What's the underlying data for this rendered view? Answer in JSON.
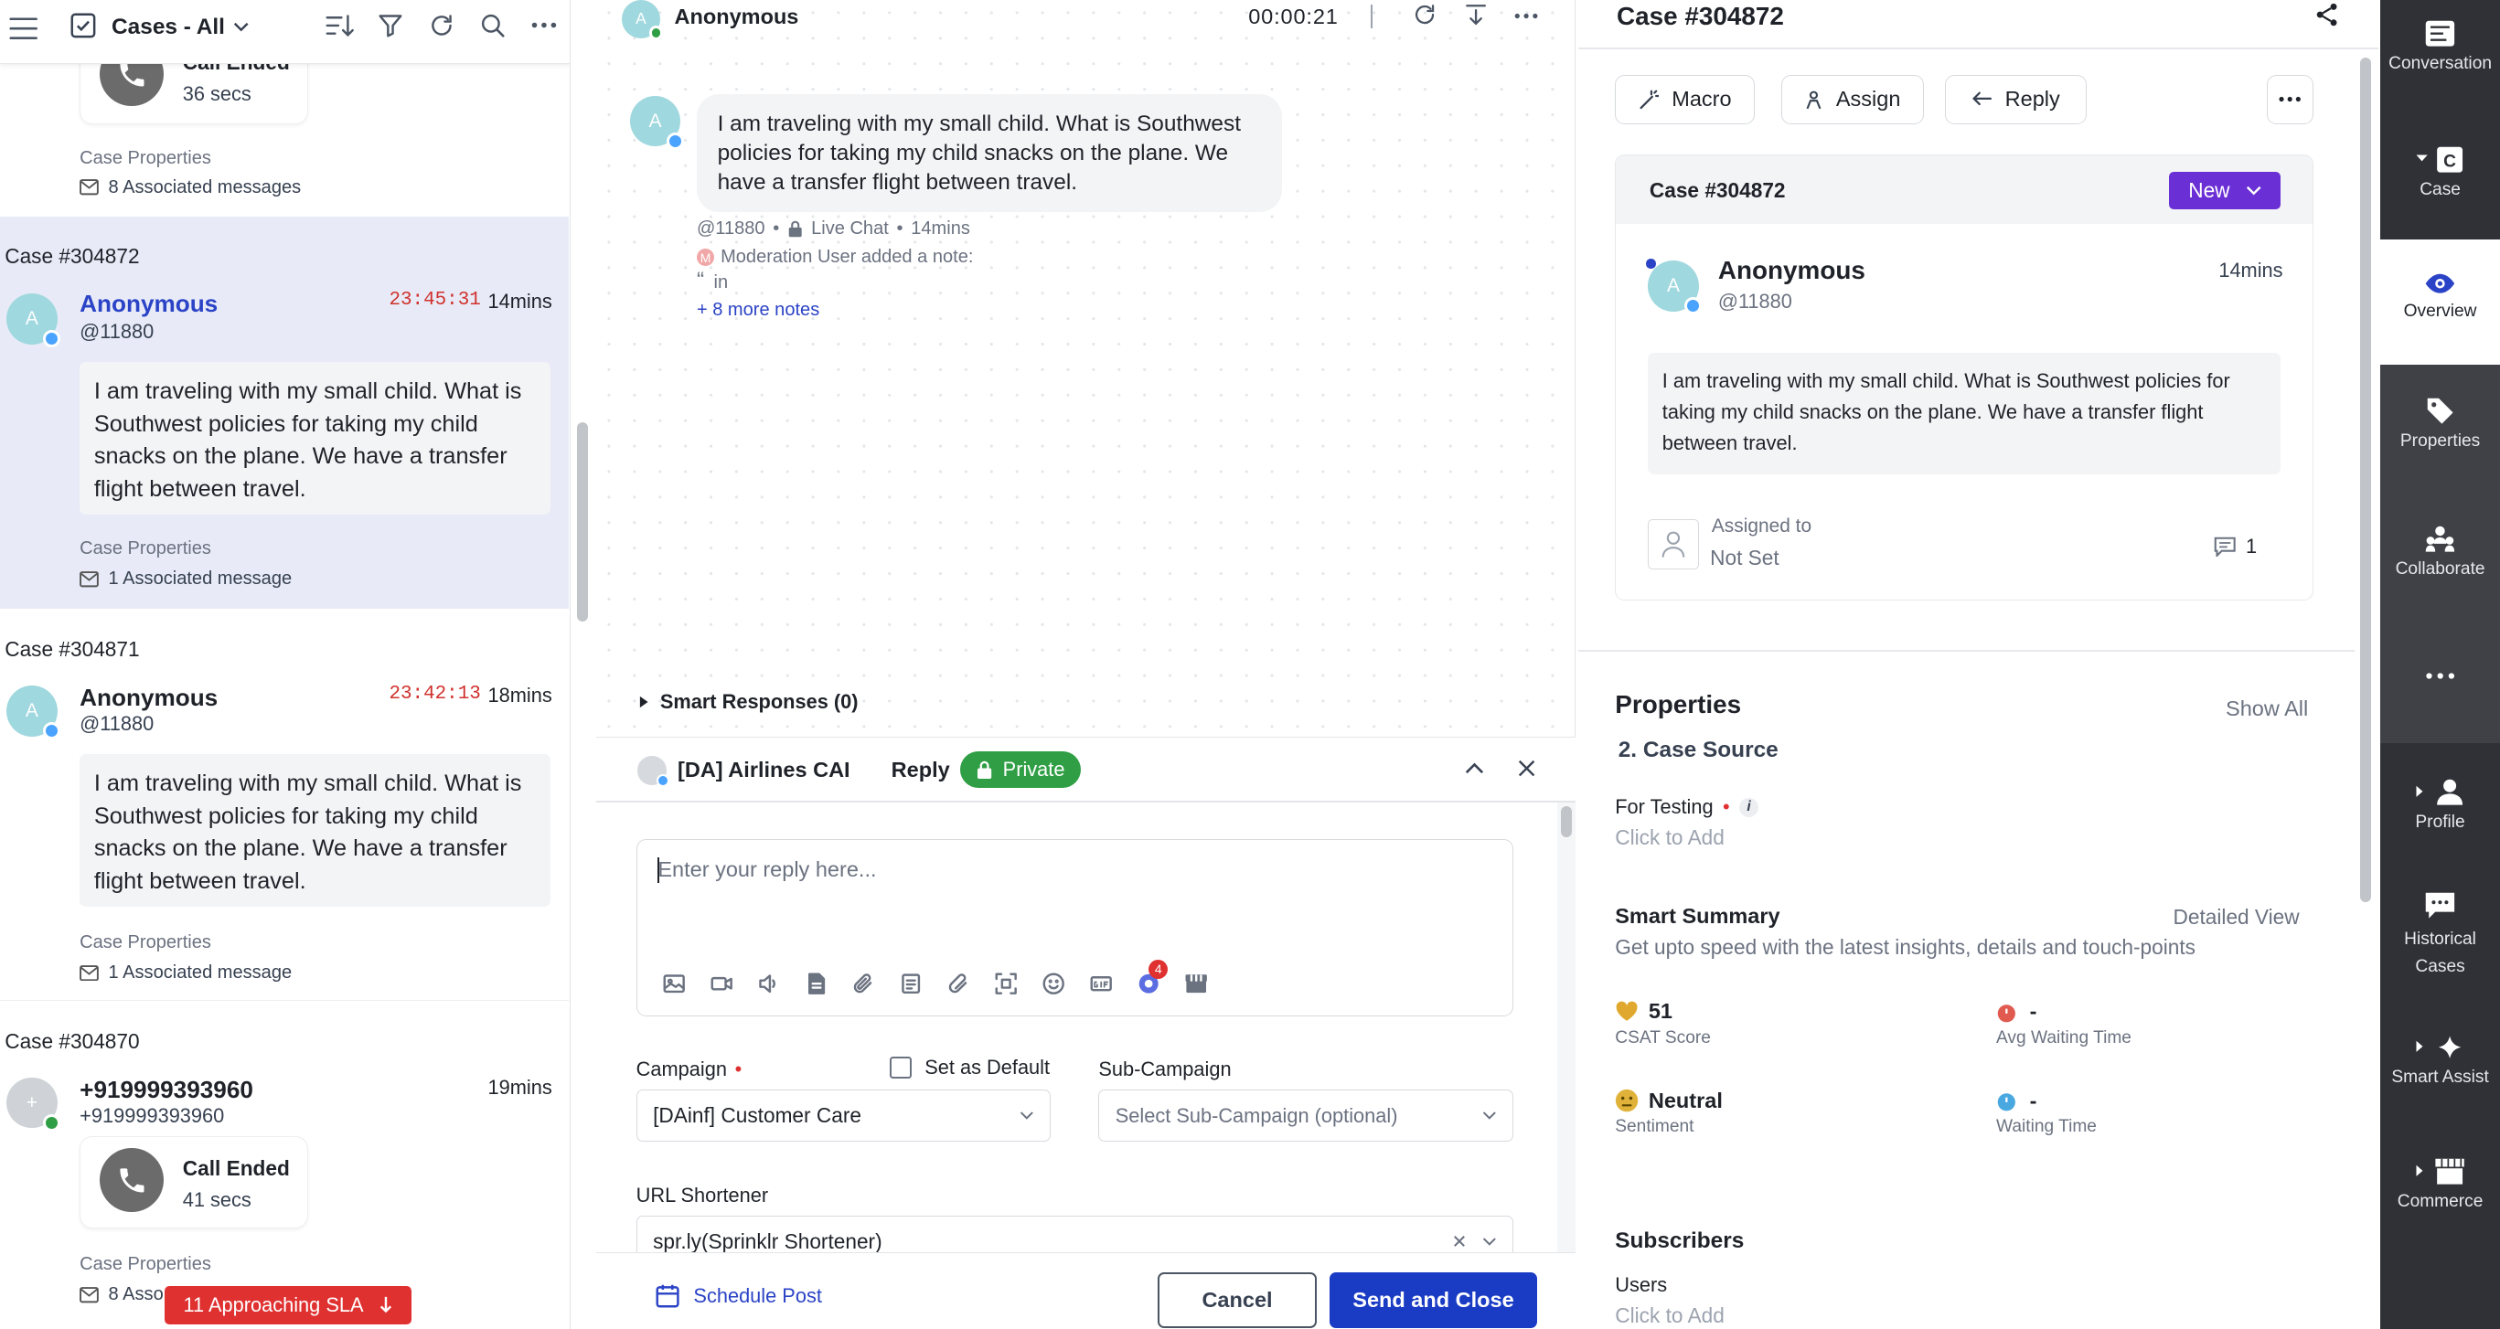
{
  "left": {
    "header_title": "Cases - All",
    "top_call": {
      "title": "Call Ended",
      "duration": "36 secs",
      "props": "Case Properties",
      "assoc": "8 Associated messages"
    },
    "cases": [
      {
        "case_no": "Case #304872",
        "name": "Anonymous",
        "handle": "@11880",
        "timer": "23:45:31",
        "age": "14mins",
        "message": "I am traveling with my small child. What is Southwest policies for taking my child snacks on the plane. We have a transfer flight between travel.",
        "props": "Case Properties",
        "assoc": "1 Associated message"
      },
      {
        "case_no": "Case #304871",
        "name": "Anonymous",
        "handle": "@11880",
        "timer": "23:42:13",
        "age": "18mins",
        "message": "I am traveling with my small child. What is Southwest policies for taking my child snacks on the plane. We have a transfer flight between travel.",
        "props": "Case Properties",
        "assoc": "1 Associated message"
      },
      {
        "case_no": "Case #304870",
        "name": "+919999393960",
        "handle": "+919999393960",
        "age": "19mins",
        "call_title": "Call Ended",
        "call_duration": "41 secs",
        "props": "Case Properties",
        "assoc": "8 Asso"
      }
    ],
    "sla_label": "11 Approaching SLA"
  },
  "conversation": {
    "contact_name": "Anonymous",
    "timer": "00:00:21",
    "avatar_initial": "A",
    "message": "I am traveling with my small child. What is Southwest policies for taking my child snacks on the plane. We have a transfer flight between travel.",
    "meta_handle": "@11880",
    "meta_channel": "Live Chat",
    "meta_age": "14mins",
    "note_author": "Moderation User added a note:",
    "note_text": "in",
    "more_notes": "+ 8 more notes",
    "smart_responses": "Smart Responses (0)"
  },
  "composer": {
    "account": "[DA] Airlines CAI",
    "reply_tab": "Reply",
    "private_label": "Private",
    "placeholder": "Enter your reply here...",
    "badge_count": "4",
    "campaign_label": "Campaign",
    "set_default_label": "Set as Default",
    "campaign_value": "[DAinf] Customer Care",
    "subcampaign_label": "Sub-Campaign",
    "subcampaign_placeholder": "Select Sub-Campaign (optional)",
    "url_label": "URL Shortener",
    "url_value": "spr.ly(Sprinklr Shortener)",
    "schedule_label": "Schedule Post",
    "cancel_label": "Cancel",
    "send_label": "Send and Close"
  },
  "case_panel": {
    "title": "Case #304872",
    "macro": "Macro",
    "assign": "Assign",
    "reply": "Reply",
    "card_title": "Case #304872",
    "status": "New",
    "name": "Anonymous",
    "handle": "@11880",
    "age": "14mins",
    "message": "I am traveling with my small child. What is Southwest policies for taking my child snacks on the plane. We have a transfer flight between travel.",
    "assigned_label": "Assigned to",
    "assigned_value": "Not Set",
    "comment_count": "1",
    "properties_title": "Properties",
    "show_all": "Show All",
    "case_source": "2. Case Source",
    "for_testing": "For Testing",
    "click_to_add": "Click to Add",
    "smart_summary": "Smart Summary",
    "detailed_view": "Detailed View",
    "summary_sub": "Get upto speed with the latest insights, details and touch-points",
    "csat_value": "51",
    "csat_label": "CSAT Score",
    "avg_wait_value": "-",
    "avg_wait_label": "Avg Waiting Time",
    "sentiment_value": "Neutral",
    "sentiment_label": "Sentiment",
    "wait_value": "-",
    "wait_label": "Waiting Time",
    "subscribers": "Subscribers",
    "users": "Users",
    "users_add": "Click to Add"
  },
  "rail": [
    "Conversation",
    "Case",
    "Overview",
    "Properties",
    "Collaborate",
    "Profile",
    "Historical Cases",
    "Smart Assist",
    "Commerce"
  ],
  "colors": {
    "accent": "#6b2fd6",
    "send": "#1a3cc4",
    "private": "#2f9e44",
    "sla": "#e03131",
    "timer": "#d0312d",
    "rail": "#2f3136"
  }
}
